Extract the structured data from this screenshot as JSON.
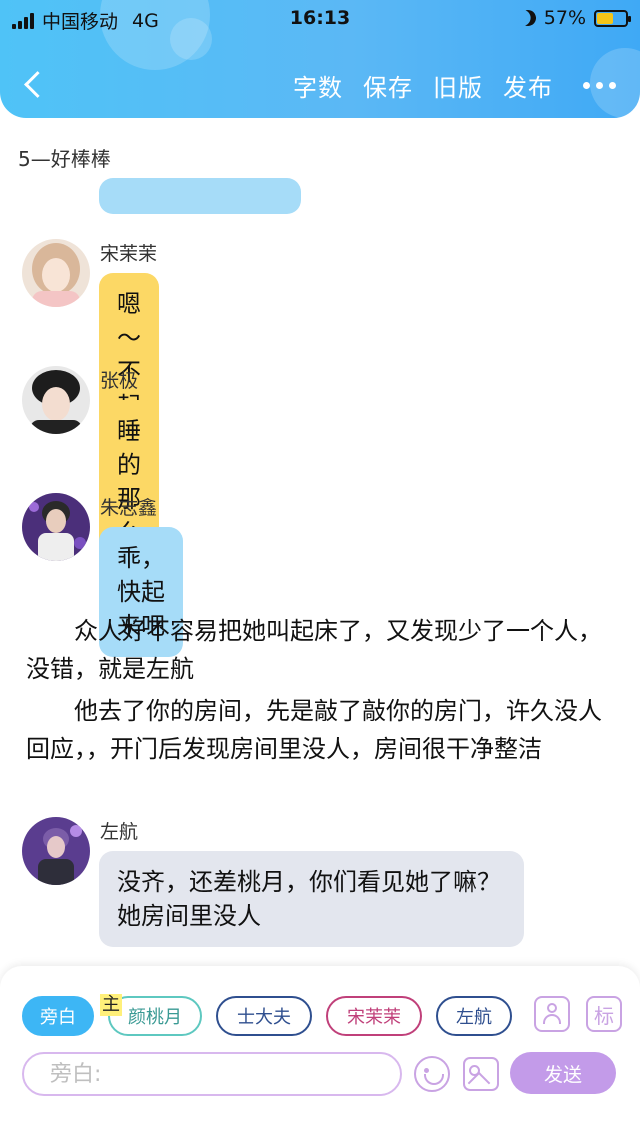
{
  "status_bar": {
    "carrier": "中国移动",
    "network": "4G",
    "time": "16:13",
    "battery": "57%",
    "battery_level": 0.57
  },
  "toolbar": {
    "word_count": "字数",
    "save": "保存",
    "old_version": "旧版",
    "publish": "发布"
  },
  "chapter_title": "5—好棒棒",
  "messages": [
    {
      "sender": "宋茉茉",
      "text": "嗯～不起～好困",
      "color": "#fcd865"
    },
    {
      "sender": "张极",
      "text": "睡的那么香啊",
      "color": "#fcd865"
    },
    {
      "sender": "朱志鑫",
      "text": "乖，快起来吧",
      "color": "#a6dcf8"
    }
  ],
  "narration": [
    "众人好不容易把她叫起床了，又发现少了一个人，没错，就是左航",
    "他去了你的房间，先是敲了敲你的房门，许久没人回应，，开门后发现房间里没人，房间很干净整洁"
  ],
  "message_4": {
    "sender": "左航",
    "text": "没齐，还差桃月，你们看见她了嘛？她房间里没人",
    "color": "#e3e6ee"
  },
  "characters": {
    "main_tag": "主",
    "narrator": "旁白",
    "items": [
      {
        "name": "颜桃月",
        "color": "#5ec8c0"
      },
      {
        "name": "士大夫",
        "color": "#2f4f8f"
      },
      {
        "name": "宋茉茉",
        "color": "#c0407a"
      },
      {
        "name": "左航",
        "color": "#2f4f8f"
      }
    ],
    "tag_button": "标"
  },
  "input": {
    "placeholder": "旁白:"
  },
  "send": "发送",
  "icons": [
    "back-icon",
    "more-icon",
    "person-icon",
    "emoji-icon",
    "image-icon"
  ]
}
